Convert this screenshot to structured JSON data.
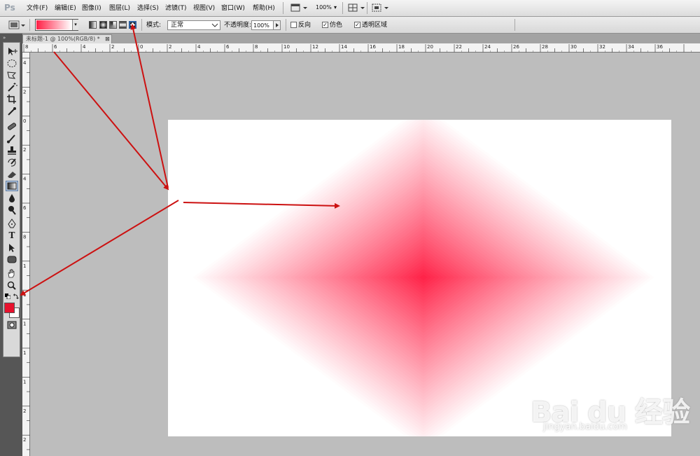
{
  "app": {
    "logo": "Ps"
  },
  "menu": {
    "items": [
      "文件(F)",
      "编辑(E)",
      "图像(I)",
      "图层(L)",
      "选择(S)",
      "滤镜(T)",
      "视图(V)",
      "窗口(W)",
      "帮助(H)"
    ],
    "zoom": "100%",
    "arrow_glyph": "▾"
  },
  "options": {
    "mode_label": "模式:",
    "mode_value": "正常",
    "opacity_label": "不透明度:",
    "opacity_value": "100%",
    "reverse_label": "反向",
    "reverse_checked": false,
    "dither_label": "仿色",
    "dither_checked": true,
    "transparency_label": "透明区域",
    "transparency_checked": true,
    "gradient_types": [
      "linear",
      "radial",
      "angle",
      "reflected",
      "diamond"
    ],
    "selected_gradient_type": "diamond",
    "gradient_colors": [
      "#ff1e44",
      "#ffffff"
    ]
  },
  "document": {
    "tab_title": "未标题-1 @ 100%(RGB/8) *",
    "close_glyph": "⊠"
  },
  "rulers": {
    "top_labels": [
      "8",
      "6",
      "4",
      "2",
      "0",
      "2",
      "4",
      "6",
      "8",
      "10",
      "12",
      "14",
      "16",
      "18",
      "20",
      "22",
      "24",
      "26",
      "28",
      "30",
      "32",
      "34",
      "36"
    ],
    "left_labels": [
      "4",
      "2",
      "0",
      "2",
      "4",
      "6",
      "8",
      "1",
      "1",
      "1",
      "1",
      "1",
      "2",
      "2"
    ]
  },
  "colors": {
    "foreground": "#e8112d",
    "background": "#ffffff",
    "gradient_center": "#ff1e44",
    "annotation_arrow": "#cc1111"
  },
  "watermark": {
    "logo": "Bai du 经验",
    "url": "jingyan.baidu.com"
  }
}
